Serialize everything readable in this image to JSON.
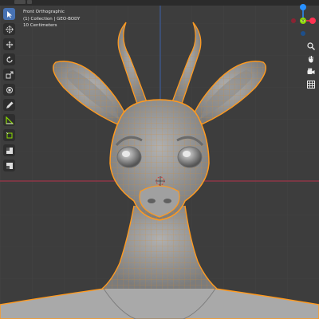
{
  "window": {
    "app": "Blender",
    "view_mode": "3D Viewport"
  },
  "overlay": {
    "view_name": "Front Orthographic",
    "collection_line": "(1) Collection | GEO-BODY",
    "scale_line": "10 Centimeters"
  },
  "toolbar": {
    "tools": [
      {
        "name": "select-box-tool",
        "icon": "cursor-icon",
        "active": true
      },
      {
        "name": "cursor-tool",
        "icon": "3d-cursor-icon",
        "active": false
      },
      {
        "name": "move-tool",
        "icon": "move-icon",
        "active": false
      },
      {
        "name": "rotate-tool",
        "icon": "rotate-icon",
        "active": false
      },
      {
        "name": "scale-tool",
        "icon": "scale-icon",
        "active": false
      },
      {
        "name": "transform-tool",
        "icon": "transform-icon",
        "active": false
      },
      {
        "name": "annotate-tool",
        "icon": "pencil-icon",
        "active": false
      },
      {
        "name": "measure-tool",
        "icon": "ruler-icon",
        "active": false
      },
      {
        "name": "add-cube-tool",
        "icon": "add-cube-icon",
        "active": false
      },
      {
        "name": "extrude-tool",
        "icon": "extrude-icon",
        "active": false
      },
      {
        "name": "inset-tool",
        "icon": "inset-icon",
        "active": false
      }
    ]
  },
  "gizmo": {
    "axes": [
      "X",
      "Y",
      "Z"
    ],
    "colors": {
      "x": "#ff3352",
      "y": "#8bdc00",
      "z": "#2890ff",
      "bg": "#3d3d3d"
    }
  },
  "nav_buttons": [
    {
      "name": "zoom-button",
      "icon": "magnify-icon"
    },
    {
      "name": "pan-button",
      "icon": "hand-icon"
    },
    {
      "name": "camera-view-button",
      "icon": "camera-icon"
    },
    {
      "name": "ortho-toggle-button",
      "icon": "grid-icon"
    }
  ],
  "scene": {
    "selected_object": "GEO-BODY",
    "outline_color": "#ff9a1f",
    "mesh_color": "#9a9a9a",
    "x_axis_color": "#b5324a",
    "z_axis_color": "#3a5ea8"
  }
}
